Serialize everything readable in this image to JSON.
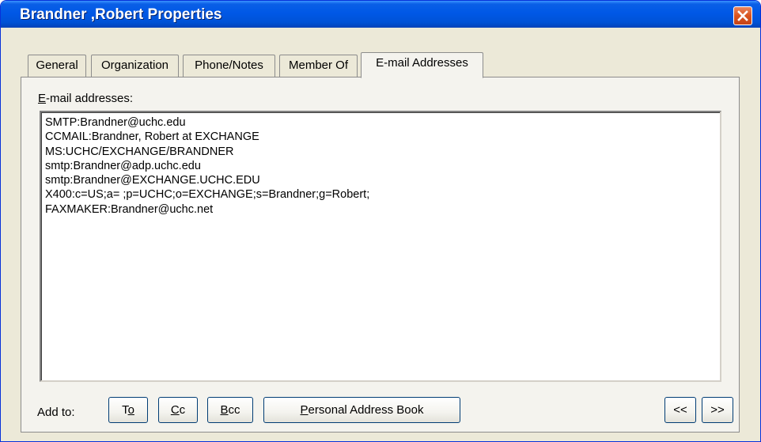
{
  "window": {
    "title": "Brandner ,Robert Properties"
  },
  "tabs": [
    {
      "label": "General"
    },
    {
      "label": "Organization"
    },
    {
      "label": "Phone/Notes"
    },
    {
      "label": "Member Of"
    },
    {
      "label": "E-mail Addresses",
      "active": true
    }
  ],
  "panel": {
    "label_first": "E",
    "label_rest": "-mail addresses:",
    "addresses": [
      "SMTP:Brandner@uchc.edu",
      "CCMAIL:Brandner, Robert at EXCHANGE",
      "MS:UCHC/EXCHANGE/BRANDNER",
      "smtp:Brandner@adp.uchc.edu",
      "smtp:Brandner@EXCHANGE.UCHC.EDU",
      "X400:c=US;a= ;p=UCHC;o=EXCHANGE;s=Brandner;g=Robert;",
      "FAXMAKER:Brandner@uchc.net"
    ]
  },
  "footer": {
    "add_to_label": "Add to:",
    "buttons": {
      "to": {
        "a": "T",
        "u": "o",
        "b": ""
      },
      "cc": {
        "a": "",
        "u": "C",
        "b": "c"
      },
      "bcc": {
        "a": "",
        "u": "B",
        "b": "cc"
      },
      "pab": {
        "a": "",
        "u": "P",
        "b": "ersonal Address Book"
      },
      "prev": "<<",
      "next": ">>"
    }
  },
  "colors": {
    "titlebar": "#0058e6",
    "close_button": "#d9531e",
    "dialog_bg": "#ece9d8"
  },
  "icons": {
    "close": "close-icon"
  }
}
